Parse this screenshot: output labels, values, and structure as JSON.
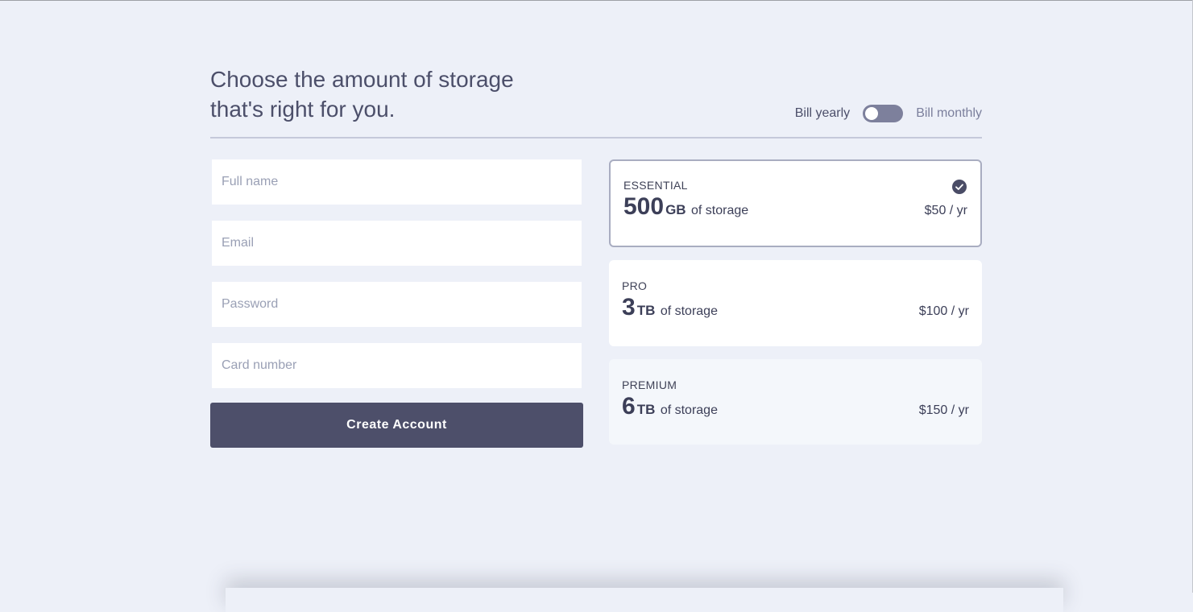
{
  "header": {
    "title_line1": "Choose the amount of storage",
    "title_line2": "that's right for you."
  },
  "billing": {
    "yearly_label": "Bill yearly",
    "monthly_label": "Bill monthly",
    "selected": "yearly"
  },
  "form": {
    "full_name_placeholder": "Full name",
    "email_placeholder": "Email",
    "password_placeholder": "Password",
    "card_placeholder": "Card number",
    "submit_label": "Create Account"
  },
  "plans": [
    {
      "name": "ESSENTIAL",
      "amount": "500",
      "unit": "GB",
      "suffix": "of storage",
      "price": "$50 / yr",
      "selected": true,
      "icon": "check-circle-icon"
    },
    {
      "name": "PRO",
      "amount": "3",
      "unit": "TB",
      "suffix": "of storage",
      "price": "$100 / yr",
      "selected": false
    },
    {
      "name": "PREMIUM",
      "amount": "6",
      "unit": "TB",
      "suffix": "of storage",
      "price": "$150 / yr",
      "selected": false
    }
  ],
  "colors": {
    "background": "#edf0f8",
    "text": "#4c4f6a",
    "button": "#4d4f6a",
    "toggle": "#7d809c",
    "selected_border": "#a9adc1"
  }
}
